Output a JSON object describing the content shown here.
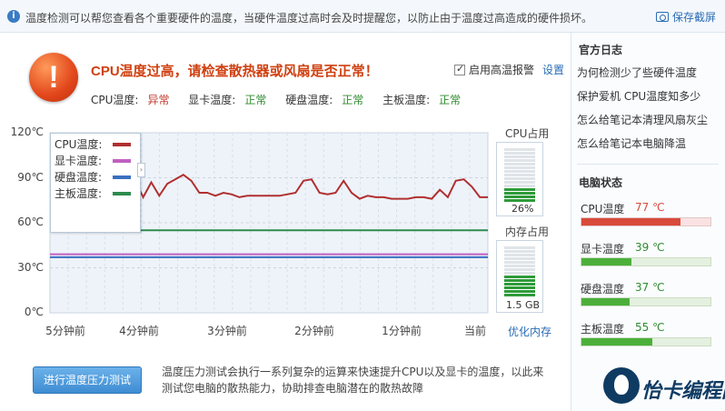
{
  "topbar": {
    "info_icon": "info-icon",
    "info_text": "温度检测可以帮您查看各个重要硬件的温度，当硬件温度过高时会及时提醒您，以防止由于温度过高造成的硬件损坏。",
    "save_screenshot": "保存截屏",
    "camera_icon": "camera-icon"
  },
  "alert": {
    "icon": "exclamation-icon",
    "icon_glyph": "!",
    "title": "CPU温度过高，请检查散热器或风扇是否正常！",
    "alarm_label": "启用高温报警",
    "alarm_checked": true,
    "settings_label": "设置"
  },
  "status": [
    {
      "label": "CPU温度:",
      "value": "异常",
      "color": "#c0392b"
    },
    {
      "label": "显卡温度:",
      "value": "正常",
      "color": "#2e8b2e"
    },
    {
      "label": "硬盘温度:",
      "value": "正常",
      "color": "#2e8b2e"
    },
    {
      "label": "主板温度:",
      "value": "正常",
      "color": "#2e8b2e"
    }
  ],
  "chart_data": {
    "type": "line",
    "title": "",
    "xlabel": "",
    "ylabel": "",
    "ylim": [
      0,
      120
    ],
    "y_ticks": [
      "120℃",
      "90℃",
      "60℃",
      "30℃",
      "0℃"
    ],
    "x_ticks": [
      "5分钟前",
      "4分钟前",
      "3分钟前",
      "2分钟前",
      "1分钟前",
      "当前"
    ],
    "grid": true,
    "legend_position": "top-left",
    "series": [
      {
        "name": "CPU温度:",
        "color": "#b03030",
        "values": [
          80,
          88,
          77,
          87,
          78,
          86,
          89,
          92,
          88,
          80,
          80,
          78,
          80,
          79,
          77,
          78,
          78,
          78,
          78,
          78,
          79,
          80,
          88,
          89,
          80,
          79,
          80,
          88,
          80,
          76,
          78,
          77,
          77,
          76,
          76,
          76,
          77,
          77,
          76,
          82,
          77,
          88,
          89,
          84,
          77,
          77
        ]
      },
      {
        "name": "显卡温度:",
        "color": "#c060c0",
        "values": [
          39,
          39
        ]
      },
      {
        "name": "硬盘温度:",
        "color": "#3a6fc0",
        "values": [
          37,
          37
        ]
      },
      {
        "name": "主板温度:",
        "color": "#2e8b4e",
        "values": [
          55,
          55
        ]
      }
    ]
  },
  "legend_toggle_glyph": "›",
  "meters": {
    "cpu": {
      "title": "CPU占用",
      "value_text": "26%",
      "fraction": 0.26
    },
    "memory": {
      "title": "内存占用",
      "value_text": "1.5 GB",
      "fraction": 0.45
    }
  },
  "optimize_memory": "优化内存",
  "stress": {
    "button": "进行温度压力测试",
    "description": "温度压力测试会执行一系列复杂的运算来快速提升CPU以及显卡的温度，以此来测试您电脑的散热能力，协助排查电脑潜在的散热故障"
  },
  "sidebar": {
    "log_title": "官方日志",
    "log_items": [
      "为何检测少了些硬件温度",
      "保护爱机 CPU温度知多少",
      "怎么给笔记本清理风扇灰尘",
      "怎么给笔记本电脑降温"
    ],
    "status_title": "电脑状态",
    "stats": [
      {
        "label": "CPU温度",
        "value": "77 ℃",
        "fraction": 0.77,
        "color": "#d84a3a",
        "value_color": "#d84a3a"
      },
      {
        "label": "显卡温度",
        "value": "39 ℃",
        "fraction": 0.39,
        "color": "#4caf3a",
        "value_color": "#2e8b2e"
      },
      {
        "label": "硬盘温度",
        "value": "37 ℃",
        "fraction": 0.37,
        "color": "#4caf3a",
        "value_color": "#2e8b2e"
      },
      {
        "label": "主板温度",
        "value": "55 ℃",
        "fraction": 0.55,
        "color": "#4caf3a",
        "value_color": "#2e8b2e"
      }
    ]
  },
  "watermark": {
    "logo": "penguin-logo",
    "text": "怡卡编程网"
  }
}
